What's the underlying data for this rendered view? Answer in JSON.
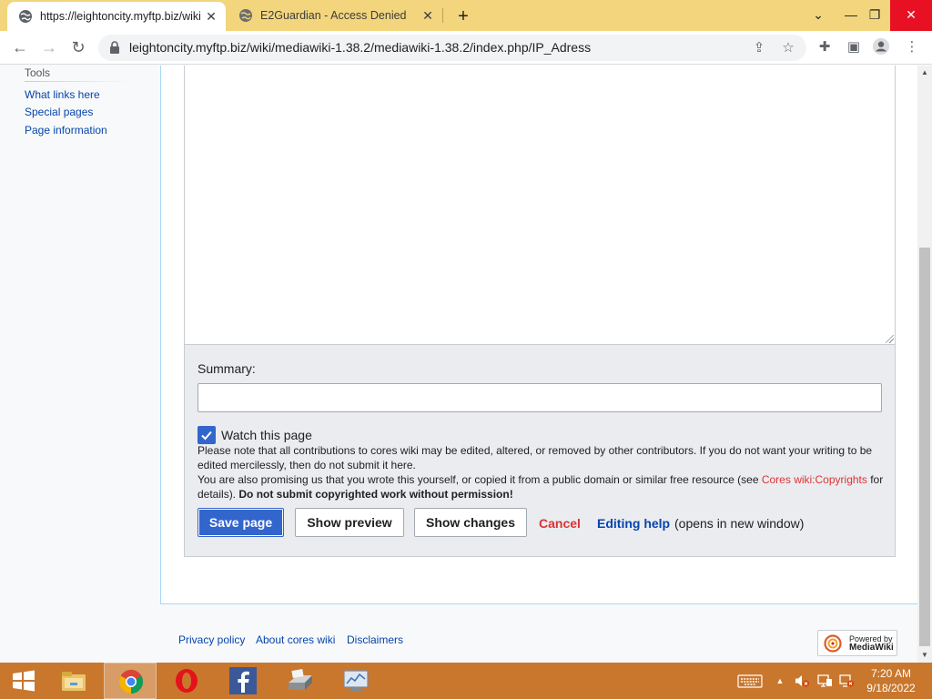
{
  "browser": {
    "tabs": [
      {
        "title": "https://leightoncity.myftp.biz/wiki",
        "active": true
      },
      {
        "title": "E2Guardian - Access Denied",
        "active": false
      }
    ],
    "url": "leightoncity.myftp.biz/wiki/mediawiki-1.38.2/mediawiki-1.38.2/index.php/IP_Adress",
    "window_controls": {
      "minimize": "⌄",
      "restore": "—",
      "maximize": "❐",
      "close": "✕"
    }
  },
  "sidebar": {
    "heading": "Tools",
    "links": [
      "What links here",
      "Special pages",
      "Page information"
    ]
  },
  "editor": {
    "summary_label": "Summary:",
    "summary_value": "",
    "watch_label": "Watch this page",
    "watch_checked": true,
    "notice1": "Please note that all contributions to cores wiki may be edited, altered, or removed by other contributors. If you do not want your writing to be edited mercilessly, then do not submit it here.",
    "notice2_pre": "You are also promising us that you wrote this yourself, or copied it from a public domain or similar free resource (see ",
    "notice2_link": "Cores wiki:Copyrights",
    "notice2_mid": " for details). ",
    "notice2_bold": "Do not submit copyrighted work without permission!",
    "buttons": {
      "save": "Save page",
      "preview": "Show preview",
      "changes": "Show changes"
    },
    "cancel": "Cancel",
    "help_link": "Editing help",
    "help_note": "(opens in new window)"
  },
  "footer": {
    "links": [
      "Privacy policy",
      "About cores wiki",
      "Disclaimers"
    ],
    "powered_line1": "Powered by",
    "powered_line2": "MediaWiki"
  },
  "taskbar": {
    "apps": [
      "file-explorer",
      "chrome",
      "opera",
      "facebook",
      "scanner",
      "network-monitor"
    ],
    "active_app": "chrome",
    "time": "7:20 AM",
    "date": "9/18/2022"
  },
  "colors": {
    "tabstrip": "#f2d57c",
    "taskbar": "#c9772d",
    "link": "#0645ad",
    "primary_button": "#3366cc",
    "cancel": "#dd3333"
  }
}
